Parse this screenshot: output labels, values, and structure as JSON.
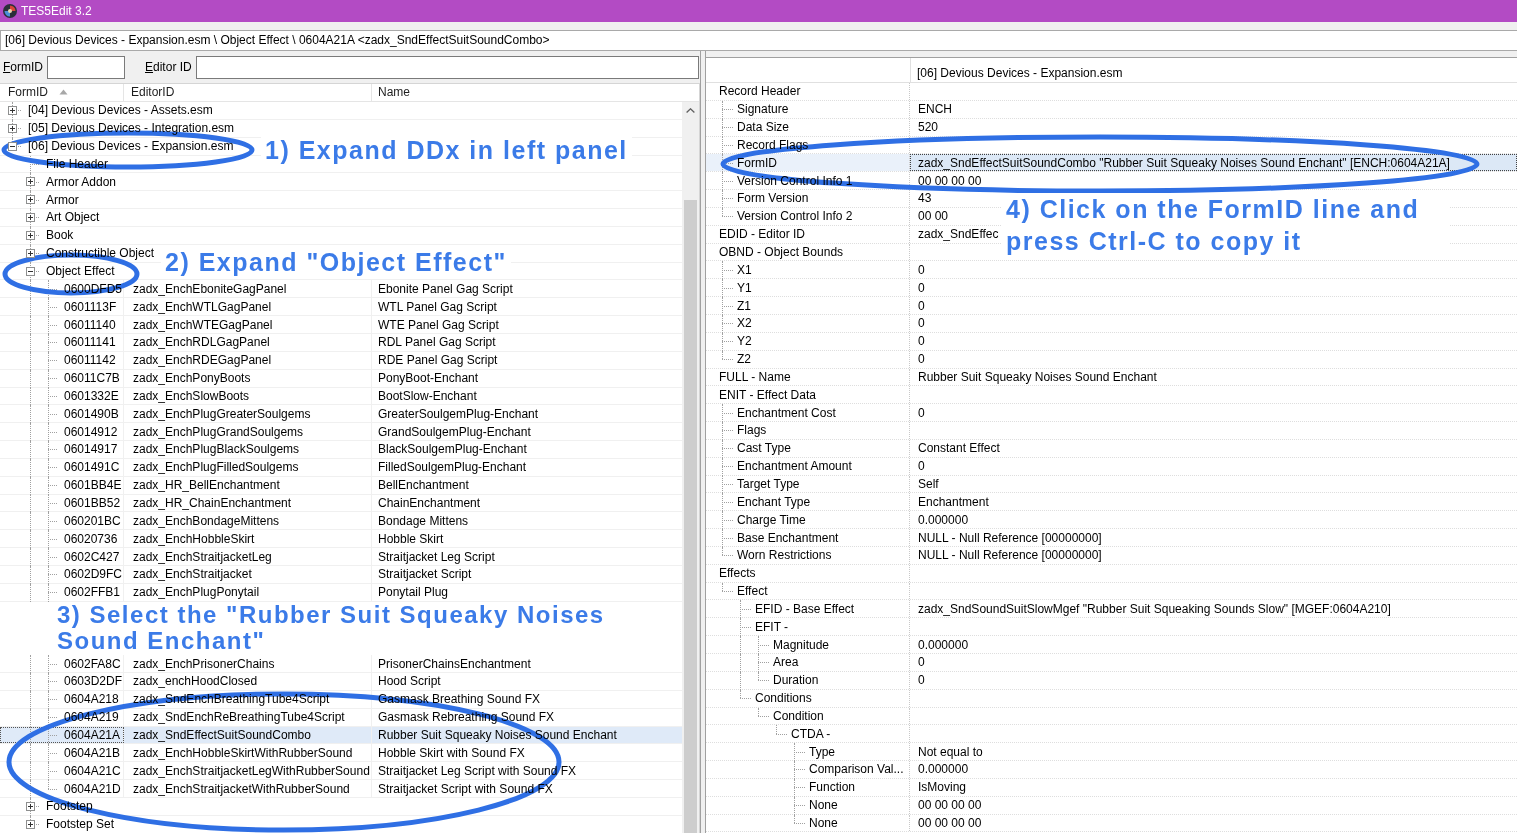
{
  "window": {
    "title": "TES5Edit 3.2"
  },
  "path_bar": {
    "value": "[06] Devious Devices - Expansion.esm \\ Object Effect \\ 0604A21A <zadx_SndEffectSuitSoundCombo>"
  },
  "filter": {
    "fields": [
      {
        "label": "FormID"
      },
      {
        "label": "Editor ID"
      }
    ]
  },
  "tree": {
    "columns": [
      {
        "label": "FormID",
        "sorted": true
      },
      {
        "label": "EditorID",
        "sorted": false
      },
      {
        "label": "Name",
        "sorted": false
      }
    ],
    "items": [
      {
        "label": "[04] Devious Devices - Assets.esm",
        "expanded": false,
        "selected": false
      },
      {
        "label": "[05] Devious Devices - Integration.esm",
        "expanded": false,
        "selected": false
      },
      {
        "label": "[06] Devious Devices - Expansion.esm",
        "expanded": true,
        "selected": false,
        "children": [
          {
            "label": "File Header",
            "selected": false
          },
          {
            "label": "Armor Addon",
            "expanded": false,
            "selected": false
          },
          {
            "label": "Armor",
            "expanded": false,
            "selected": false
          },
          {
            "label": "Art Object",
            "expanded": false,
            "selected": false
          },
          {
            "label": "Book",
            "expanded": false,
            "selected": false
          },
          {
            "label": "Constructible Object",
            "expanded": false,
            "selected": false
          },
          {
            "label": "Object Effect",
            "expanded": true,
            "selected": false,
            "children": [
              {
                "kind": "record",
                "form_id": "0600DFD5",
                "editor_id": "zadx_EnchEboniteGagPanel",
                "name": "Ebonite Panel Gag Script",
                "selected": false
              },
              {
                "kind": "record",
                "form_id": "0601113F",
                "editor_id": "zadx_EnchWTLGagPanel",
                "name": "WTL Panel Gag Script",
                "selected": false
              },
              {
                "kind": "record",
                "form_id": "06011140",
                "editor_id": "zadx_EnchWTEGagPanel",
                "name": "WTE Panel Gag Script",
                "selected": false
              },
              {
                "kind": "record",
                "form_id": "06011141",
                "editor_id": "zadx_EnchRDLGagPanel",
                "name": "RDL Panel Gag Script",
                "selected": false
              },
              {
                "kind": "record",
                "form_id": "06011142",
                "editor_id": "zadx_EnchRDEGagPanel",
                "name": "RDE Panel Gag Script",
                "selected": false
              },
              {
                "kind": "record",
                "form_id": "06011C7B",
                "editor_id": "zadx_EnchPonyBoots",
                "name": "PonyBoot-Enchant",
                "selected": false
              },
              {
                "kind": "record",
                "form_id": "0601332E",
                "editor_id": "zadx_EnchSlowBoots",
                "name": "BootSlow-Enchant",
                "selected": false
              },
              {
                "kind": "record",
                "form_id": "0601490B",
                "editor_id": "zadx_EnchPlugGreaterSoulgems",
                "name": "GreaterSoulgemPlug-Enchant",
                "selected": false
              },
              {
                "kind": "record",
                "form_id": "06014912",
                "editor_id": "zadx_EnchPlugGrandSoulgems",
                "name": "GrandSoulgemPlug-Enchant",
                "selected": false
              },
              {
                "kind": "record",
                "form_id": "06014917",
                "editor_id": "zadx_EnchPlugBlackSoulgems",
                "name": "BlackSoulgemPlug-Enchant",
                "selected": false
              },
              {
                "kind": "record",
                "form_id": "0601491C",
                "editor_id": "zadx_EnchPlugFilledSoulgems",
                "name": "FilledSoulgemPlug-Enchant",
                "selected": false
              },
              {
                "kind": "record",
                "form_id": "0601BB4E",
                "editor_id": "zadx_HR_BellEnchantment",
                "name": "BellEnchantment",
                "selected": false
              },
              {
                "kind": "record",
                "form_id": "0601BB52",
                "editor_id": "zadx_HR_ChainEnchantment",
                "name": "ChainEnchantment",
                "selected": false
              },
              {
                "kind": "record",
                "form_id": "060201BC",
                "editor_id": "zadx_EnchBondageMittens",
                "name": "Bondage Mittens",
                "selected": false
              },
              {
                "kind": "record",
                "form_id": "06020736",
                "editor_id": "zadx_EnchHobbleSkirt",
                "name": "Hobble Skirt",
                "selected": false
              },
              {
                "kind": "record",
                "form_id": "0602C427",
                "editor_id": "zadx_EnchStraitjacketLeg",
                "name": "Straitjacket Leg Script",
                "selected": false
              },
              {
                "kind": "record",
                "form_id": "0602D9FC",
                "editor_id": "zadx_EnchStraitjacket",
                "name": "Straitjacket Script",
                "selected": false
              },
              {
                "kind": "record",
                "form_id": "0602FFB1",
                "editor_id": "zadx_EnchPlugPonytail",
                "name": "Ponytail Plug",
                "selected": false
              },
              {
                "kind": "callout",
                "text": "3) Select the \"Rubber Suit Squeaky Noises Sound Enchant\""
              },
              {
                "kind": "record",
                "form_id": "0602FA8C",
                "editor_id": "zadx_EnchPrisonerChains",
                "name": "PrisonerChainsEnchantment",
                "selected": false
              },
              {
                "kind": "record",
                "form_id": "0603D2DF",
                "editor_id": "zadx_enchHoodClosed",
                "name": "Hood Script",
                "selected": false
              },
              {
                "kind": "record",
                "form_id": "0604A218",
                "editor_id": "zadx_SndEnchBreathingTube4Script",
                "name": "Gasmask Breathing Sound FX",
                "selected": false
              },
              {
                "kind": "record",
                "form_id": "0604A219",
                "editor_id": "zadx_SndEnchReBreathingTube4Script",
                "name": "Gasmask Rebreathing Sound FX",
                "selected": false
              },
              {
                "kind": "record",
                "form_id": "0604A21A",
                "editor_id": "zadx_SndEffectSuitSoundCombo",
                "name": "Rubber Suit Squeaky Noises Sound Enchant",
                "selected": true
              },
              {
                "kind": "record",
                "form_id": "0604A21B",
                "editor_id": "zadx_EnchHobbleSkirtWithRubberSound",
                "name": "Hobble Skirt with Sound FX",
                "selected": false
              },
              {
                "kind": "record",
                "form_id": "0604A21C",
                "editor_id": "zadx_EnchStraitjacketLegWithRubberSound",
                "name": "Straitjacket Leg Script with Sound FX",
                "selected": false
              },
              {
                "kind": "record",
                "form_id": "0604A21D",
                "editor_id": "zadx_EnchStraitjacketWithRubberSound",
                "name": "Straitjacket Script with Sound FX",
                "selected": false
              }
            ]
          },
          {
            "label": "Footstep",
            "expanded": false,
            "selected": false
          },
          {
            "label": "Footstep Set",
            "expanded": false,
            "selected": false
          }
        ]
      }
    ]
  },
  "record_view": {
    "column_header": "[06] Devious Devices - Expansion.esm",
    "rows": [
      {
        "label": "Record Header",
        "selected": false,
        "children": [
          {
            "label": "Signature",
            "value": "ENCH",
            "selected": false
          },
          {
            "label": "Data Size",
            "value": "520",
            "selected": false
          },
          {
            "label": "Record Flags",
            "selected": false
          },
          {
            "label": "FormID",
            "value": "zadx_SndEffectSuitSoundCombo \"Rubber Suit Squeaky Noises Sound Enchant\" [ENCH:0604A21A]",
            "selected": true
          },
          {
            "label": "Version Control Info 1",
            "value": "00 00 00 00",
            "selected": false
          },
          {
            "label": "Form Version",
            "value": "43",
            "selected": false
          },
          {
            "label": "Version Control Info 2",
            "value": "00 00",
            "selected": false
          }
        ]
      },
      {
        "label": "EDID - Editor ID",
        "value": "zadx_SndEffec",
        "selected": false
      },
      {
        "label": "OBND - Object Bounds",
        "selected": false,
        "children": [
          {
            "label": "X1",
            "value": "0",
            "selected": false
          },
          {
            "label": "Y1",
            "value": "0",
            "selected": false
          },
          {
            "label": "Z1",
            "value": "0",
            "selected": false
          },
          {
            "label": "X2",
            "value": "0",
            "selected": false
          },
          {
            "label": "Y2",
            "value": "0",
            "selected": false
          },
          {
            "label": "Z2",
            "value": "0",
            "selected": false
          }
        ]
      },
      {
        "label": "FULL - Name",
        "value": "Rubber Suit Squeaky Noises Sound Enchant",
        "selected": false
      },
      {
        "label": "ENIT - Effect Data",
        "selected": false,
        "children": [
          {
            "label": "Enchantment Cost",
            "value": "0",
            "selected": false
          },
          {
            "label": "Flags",
            "selected": false
          },
          {
            "label": "Cast Type",
            "value": "Constant Effect",
            "selected": false
          },
          {
            "label": "Enchantment Amount",
            "value": "0",
            "selected": false
          },
          {
            "label": "Target Type",
            "value": "Self",
            "selected": false
          },
          {
            "label": "Enchant Type",
            "value": "Enchantment",
            "selected": false
          },
          {
            "label": "Charge Time",
            "value": "0.000000",
            "selected": false
          },
          {
            "label": "Base Enchantment",
            "value": "NULL - Null Reference [00000000]",
            "selected": false
          },
          {
            "label": "Worn Restrictions",
            "value": "NULL - Null Reference [00000000]",
            "selected": false
          }
        ]
      },
      {
        "label": "Effects",
        "selected": false,
        "children": [
          {
            "label": "Effect",
            "selected": false,
            "children": [
              {
                "label": "EFID - Base Effect",
                "value": "zadx_SndSoundSuitSlowMgef \"Rubber Suit Squeaking Sounds Slow\" [MGEF:0604A210]",
                "selected": false
              },
              {
                "label": "EFIT -",
                "selected": false,
                "children": [
                  {
                    "label": "Magnitude",
                    "value": "0.000000",
                    "selected": false
                  },
                  {
                    "label": "Area",
                    "value": "0",
                    "selected": false
                  },
                  {
                    "label": "Duration",
                    "value": "0",
                    "selected": false
                  }
                ]
              },
              {
                "label": "Conditions",
                "selected": false,
                "children": [
                  {
                    "label": "Condition",
                    "selected": false,
                    "children": [
                      {
                        "label": "CTDA -",
                        "selected": false,
                        "children": [
                          {
                            "label": "Type",
                            "value": "Not equal to",
                            "selected": false
                          },
                          {
                            "label": "Comparison Val...",
                            "value": "0.000000",
                            "selected": false
                          },
                          {
                            "label": "Function",
                            "value": "IsMoving",
                            "selected": false
                          },
                          {
                            "label": "None",
                            "value": "00 00 00 00",
                            "selected": false
                          },
                          {
                            "label": "None",
                            "value": "00 00 00 00",
                            "selected": false
                          }
                        ]
                      }
                    ]
                  }
                ]
              }
            ]
          }
        ]
      }
    ]
  },
  "callouts": [
    "1) Expand DDx in left panel",
    "2) Expand \"Object Effect\"",
    "4) Click on the FormID line and press Ctrl-C to copy it"
  ]
}
